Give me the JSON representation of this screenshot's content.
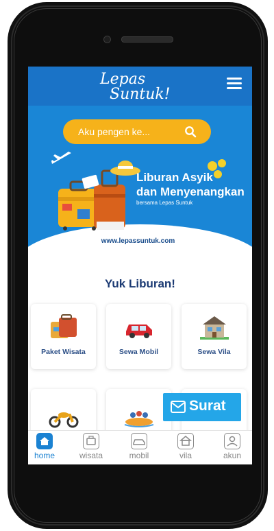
{
  "header": {
    "logo_line1": "Lepas",
    "logo_line2": "Suntuk!"
  },
  "search": {
    "placeholder": "Aku pengen ke..."
  },
  "hero": {
    "title_line1": "Liburan Asyik",
    "title_line2": "dan Menyenangkan",
    "subtitle": "bersama Lepas Suntuk",
    "url": "www.lepassuntuk.com"
  },
  "section": {
    "title": "Yuk Liburan!"
  },
  "categories": [
    {
      "label": "Paket Wisata",
      "icon": "suitcase-icon"
    },
    {
      "label": "Sewa Mobil",
      "icon": "car-icon"
    },
    {
      "label": "Sewa Vila",
      "icon": "house-icon"
    },
    {
      "label": "",
      "icon": "motorbike-icon"
    },
    {
      "label": "",
      "icon": "rafting-icon"
    },
    {
      "label": "",
      "icon": "other-icon"
    }
  ],
  "fab": {
    "label": "Surat",
    "icon": "mail-icon"
  },
  "bottom_nav": [
    {
      "label": "home",
      "icon": "home-icon",
      "active": true
    },
    {
      "label": "wisata",
      "icon": "wisata-icon",
      "active": false
    },
    {
      "label": "mobil",
      "icon": "car-icon",
      "active": false
    },
    {
      "label": "vila",
      "icon": "vila-icon",
      "active": false
    },
    {
      "label": "akun",
      "icon": "account-icon",
      "active": false
    }
  ],
  "colors": {
    "primary": "#1a73c7",
    "hero": "#1a86d6",
    "search": "#f6b21a",
    "fab": "#24a6e8",
    "title": "#1b3a73"
  }
}
